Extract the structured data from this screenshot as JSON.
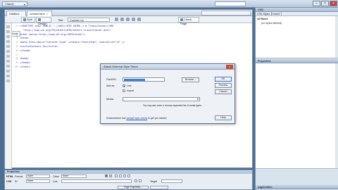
{
  "app": {
    "workspace_label": "Classic",
    "window_controls": [
      "–",
      "□",
      "×"
    ]
  },
  "document": {
    "tabs": [
      {
        "label": "Untitled-1",
        "close": "×"
      },
      {
        "label": "contact.html",
        "close": "×"
      }
    ],
    "toolbar": {
      "code_label": "Code",
      "split_label": "Split",
      "design_label": "Design",
      "title_label": "Title:",
      "title_value": "Contact Us",
      "check_page_label": "Check Page"
    },
    "code_lines": [
      {
        "num": "1",
        "text": "<!DOCTYPE html PUBLIC \"-//W3C//DTD XHTML 1.0 Transitional//EN\""
      },
      {
        "num": "",
        "text": "  \"http://www.w3.org/TR/xhtml1/DTD/xhtml1-transitional.dtd\">"
      },
      {
        "num": "2",
        "text": "<html xmlns=\"http://www.w3.org/1999/xhtml\">"
      },
      {
        "num": "3",
        "text": "<head>"
      },
      {
        "num": "4",
        "text": "<meta http-equiv=\"Content-Type\" content=\"text/html; charset=utf-8\" />"
      },
      {
        "num": "5",
        "text": "<title>Contact Us</title>"
      },
      {
        "num": "6",
        "text": "</head>"
      },
      {
        "num": "7",
        "text": ""
      },
      {
        "num": "8",
        "text": "<body>"
      },
      {
        "num": "9",
        "text": "</body>"
      },
      {
        "num": "10",
        "text": "</html>"
      }
    ]
  },
  "dialog": {
    "title": "Attach External Style Sheet",
    "close": "×",
    "file_url_label": "File/URL:",
    "file_url_value": "",
    "browse_label": "Browse...",
    "add_as_label": "Add as:",
    "link_label": "Link",
    "import_label": "Import",
    "media_label": "Media:",
    "media_value": "",
    "hint": "You may also enter a comma-separated list of media types.",
    "sample_prefix": "Dreamweaver has",
    "sample_link": "sample style sheets",
    "sample_suffix": "to get you started.",
    "ok_label": "OK",
    "preview_label": "Preview",
    "cancel_label": "Cancel",
    "help_label": "Help"
  },
  "right_panel": {
    "css_header": "CSS",
    "css_tabs": [
      "CSS Styles",
      "Current"
    ],
    "all_rules_label": "All Rules",
    "style_item": "(no styles defined)",
    "properties_header": "Properties",
    "bottom_header": "Application"
  },
  "properties": {
    "header": "Properties",
    "html_label": "HTML",
    "css_label": "CSS",
    "format_label": "Format",
    "format_value": "None",
    "class_label": "Class",
    "class_value": "None",
    "id_label": "ID",
    "id_value": "None",
    "link_label": "Link",
    "bold": "B",
    "italic": "I",
    "target_label": "Target",
    "page_properties_label": "Page Properties..."
  }
}
